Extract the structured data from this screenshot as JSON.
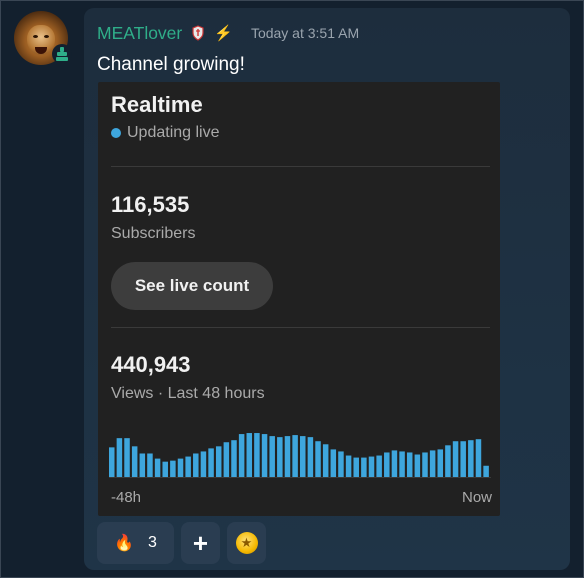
{
  "message": {
    "username": "MEATlover",
    "timestamp": "Today at 3:51 AM",
    "text": "Channel growing!",
    "username_color": "#2fae89"
  },
  "embed": {
    "title": "Realtime",
    "live_status": "Updating live",
    "subscribers": {
      "count": "116,535",
      "label": "Subscribers"
    },
    "live_count_button": "See live count",
    "views": {
      "count": "440,943",
      "label": "Views · Last 48 hours"
    },
    "accent_color": "#3ea6dd"
  },
  "chart_data": {
    "type": "bar",
    "x_start_label": "-48h",
    "x_end_label": "Now",
    "values": [
      29,
      38,
      38,
      30,
      23,
      23,
      18,
      15,
      16,
      18,
      20,
      23,
      25,
      28,
      30,
      34,
      36,
      42,
      43,
      43,
      42,
      40,
      39,
      40,
      41,
      40,
      39,
      35,
      32,
      27,
      25,
      21,
      19,
      19,
      20,
      21,
      24,
      26,
      25,
      24,
      22,
      24,
      26,
      27,
      31,
      35,
      35,
      36,
      37,
      11
    ],
    "ylim": [
      0,
      45
    ]
  },
  "reactions": [
    {
      "icon": "fire-icon",
      "emoji": "🔥",
      "count": "3"
    },
    {
      "icon": "add-reaction-icon",
      "label": "+"
    },
    {
      "icon": "coin-icon",
      "emoji": "★"
    }
  ]
}
